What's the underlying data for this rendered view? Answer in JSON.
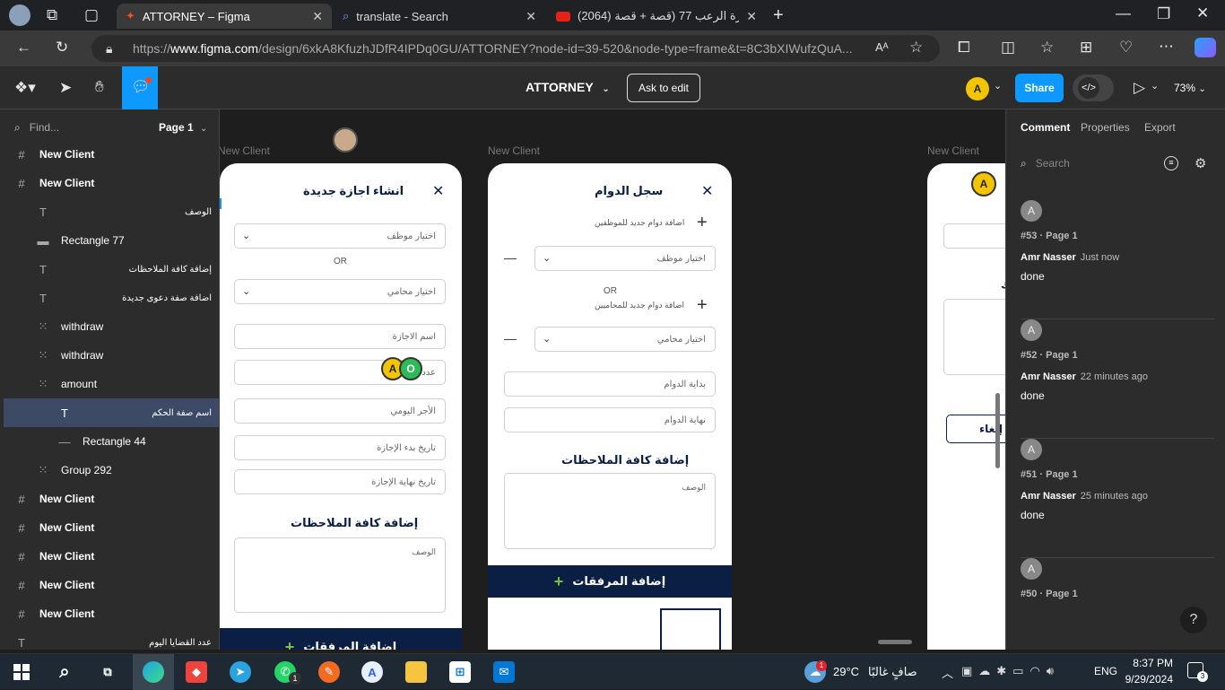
{
  "browser": {
    "tabs": [
      {
        "label": "ATTORNEY – Figma",
        "active": true
      },
      {
        "label": "translate - Search",
        "active": false
      },
      {
        "label": "(2064) سهرة الرعب 77 (قصة + قصة",
        "active": false
      }
    ],
    "url_prefix": "https://",
    "url_domain": "www.figma.com",
    "url_rest": "/design/6xkA8KfuzhJDfR4IPDq0GU/ATTORNEY?node-id=39-520&node-type=frame&t=8C3bXIWufzQuA..."
  },
  "toolbar": {
    "file_title": "ATTORNEY",
    "ask_to_edit": "Ask to edit",
    "share": "Share",
    "zoom": "73%",
    "avatar": "A"
  },
  "left_panel": {
    "search_placeholder": "Find...",
    "page": "Page 1",
    "layers": [
      {
        "label": "New Client",
        "icon": "frame-icon",
        "bold": true
      },
      {
        "label": "New Client",
        "icon": "frame-icon",
        "bold": true
      },
      {
        "label": "الوصف",
        "icon": "text-icon",
        "rtl": true
      },
      {
        "label": "Rectangle 77",
        "icon": "rect-icon"
      },
      {
        "label": "إضافة كافة الملاحظات",
        "icon": "text-icon",
        "rtl": true
      },
      {
        "label": "اضافة صفة دعوى جديدة",
        "icon": "text-icon",
        "rtl": true
      },
      {
        "label": "withdraw",
        "icon": "group-icon"
      },
      {
        "label": "withdraw",
        "icon": "group-icon"
      },
      {
        "label": "amount",
        "icon": "group-icon"
      },
      {
        "label": "اسم صفة الحكم",
        "icon": "text-icon",
        "rtl": true,
        "selected": true
      },
      {
        "label": "Rectangle 44",
        "icon": "line-icon"
      },
      {
        "label": "Group 292",
        "icon": "group-icon"
      },
      {
        "label": "New Client",
        "icon": "frame-icon",
        "bold": true
      },
      {
        "label": "New Client",
        "icon": "frame-icon",
        "bold": true
      },
      {
        "label": "New Client",
        "icon": "frame-icon",
        "bold": true
      },
      {
        "label": "New Client",
        "icon": "frame-icon",
        "bold": true
      },
      {
        "label": "New Client",
        "icon": "frame-icon",
        "bold": true
      },
      {
        "label": "عدد القضايا اليوم",
        "icon": "text-icon",
        "rtl": true
      }
    ]
  },
  "canvas": {
    "frame_label": "New Client",
    "frame1": {
      "title": "انشاء اجازة جديدة",
      "select_employee": "اختيار موظف",
      "or": "OR",
      "select_lawyer": "اختيار محامي",
      "leave_name": "اسم الاجازة",
      "days": "عدد",
      "daily_wage": "الأجر اليومي",
      "start_date": "تاريخ بدء الإجازة",
      "end_date": "تاريخ نهاية الإجازة",
      "notes_title": "إضافة كافة الملاحظات",
      "description": "الوصف",
      "attachments": "إضافة المرفقات"
    },
    "frame2": {
      "title": "سجل الدوام",
      "add_employee_shift": "اضافة دوام جديد للموظفين",
      "select_employee": "اختيار موظف",
      "or": "OR",
      "add_lawyer_shift": "اضافة دوام جديد للمحاميين",
      "select_lawyer": "اختيار محامي",
      "shift_start": "بداية الدوام",
      "shift_end": "نهاية الدوام",
      "notes_title": "إضافة كافة الملاحظات",
      "description": "الوصف",
      "attachments": "إضافة المرفقات"
    },
    "frame3": {
      "cancel": "إلغاء",
      "avatar": "A"
    },
    "cursors": {
      "a": "A",
      "o": "O"
    }
  },
  "right_panel": {
    "tabs": [
      "Comment",
      "Properties",
      "Export"
    ],
    "search_placeholder": "Search",
    "comments": [
      {
        "avatar": "A",
        "ref": "#53 · Page 1",
        "author": "Amr Nasser",
        "time": "Just now",
        "text": "done"
      },
      {
        "avatar": "A",
        "ref": "#52 · Page 1",
        "author": "Amr Nasser",
        "time": "22 minutes ago",
        "text": "done"
      },
      {
        "avatar": "A",
        "ref": "#51 · Page 1",
        "author": "Amr Nasser",
        "time": "25 minutes ago",
        "text": "done"
      },
      {
        "avatar": "A",
        "ref": "#50 · Page 1",
        "author": "",
        "time": "",
        "text": ""
      }
    ],
    "help": "?"
  },
  "taskbar": {
    "weather_temp": "29°C",
    "weather_text": "صافٍ غالبًا",
    "lang": "ENG",
    "time": "8:37 PM",
    "date": "9/29/2024",
    "notif_count": "3",
    "whatsapp_badge": "1",
    "weather_badge": "1"
  }
}
